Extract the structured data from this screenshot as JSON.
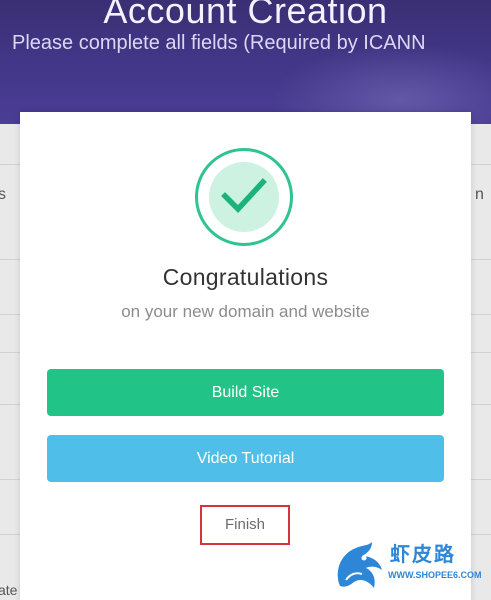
{
  "page": {
    "title": "Account Creation",
    "subtitle": "Please complete all fields (Required by ICANN",
    "fragments": {
      "left_mid": "s",
      "right_mid": "n",
      "bottom_left": "ate"
    }
  },
  "modal": {
    "icon": "checkmark-icon",
    "title": "Congratulations",
    "subtitle": "on your new domain and website",
    "build_site_label": "Build Site",
    "video_tutorial_label": "Video Tutorial",
    "finish_label": "Finish"
  },
  "watermark": {
    "cn_text": "虾皮路",
    "url_text": "WWW.SHOPEE6.COM"
  },
  "colors": {
    "header": "#43378a",
    "success_green": "#21c486",
    "video_blue": "#4fbfe9",
    "highlight_red": "#d6343c",
    "watermark_blue": "#2e86d6"
  }
}
